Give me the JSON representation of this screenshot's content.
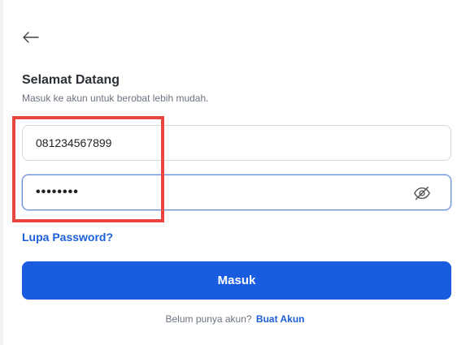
{
  "back": {
    "icon": "arrow-left-icon"
  },
  "header": {
    "title": "Selamat Datang",
    "subtitle": "Masuk ke akun untuk berobat lebih mudah."
  },
  "form": {
    "phone_value": "081234567899",
    "password_value": "••••••••",
    "password_toggle_icon": "eye-off-icon",
    "forgot_label": "Lupa Password?",
    "submit_label": "Masuk"
  },
  "signup": {
    "prompt": "Belum punya akun?",
    "link_label": "Buat Akun"
  },
  "colors": {
    "primary": "#1a5ce0",
    "link": "#1b5fd9",
    "highlight": "#e8473f"
  }
}
